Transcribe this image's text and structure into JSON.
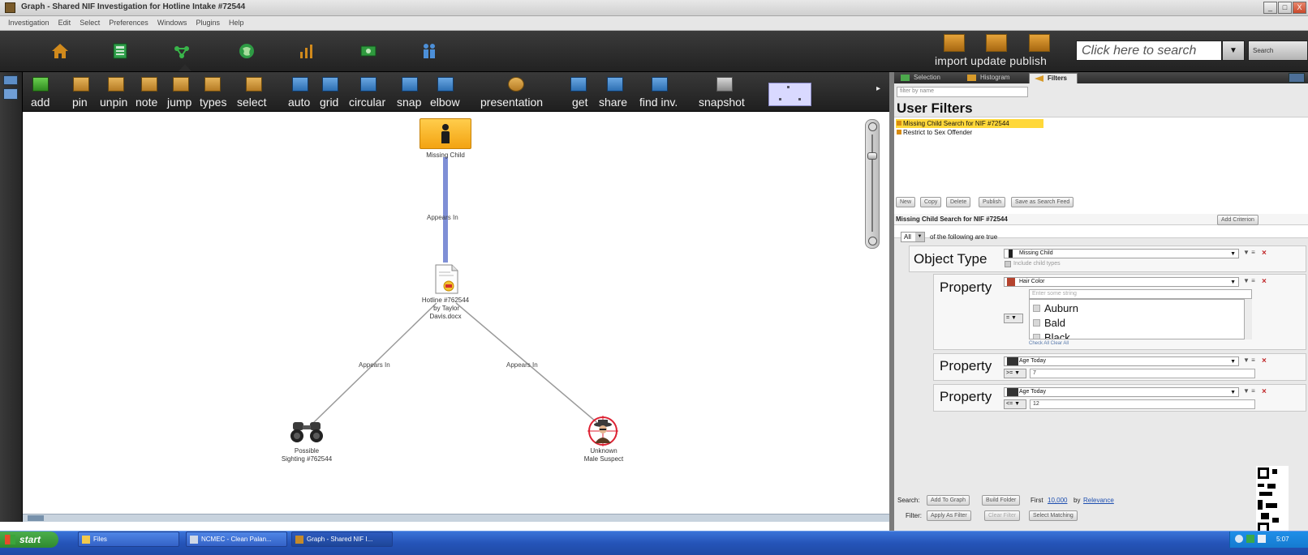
{
  "window": {
    "title": "Graph - Shared NIF Investigation for Hotline Intake #72544",
    "controls": [
      "_",
      "□",
      "X"
    ]
  },
  "menubar": {
    "items": [
      "Investigation",
      "Edit",
      "Select",
      "Preferences",
      "Windows",
      "Plugins",
      "Help"
    ]
  },
  "main_toolbar": {
    "nav_icons": [
      "home-icon",
      "browser-icon",
      "graph-icon",
      "map-icon",
      "chart-icon",
      "money-icon",
      "people-icon"
    ],
    "actions_label": "import update publish",
    "search_placeholder": "Click here to search",
    "search_button": "Search"
  },
  "graph_toolbar": {
    "buttons": [
      {
        "label": "add",
        "icon": "add-icon"
      },
      {
        "label": "pin",
        "icon": "pin-icon"
      },
      {
        "label": "unpin",
        "icon": "unpin-icon"
      },
      {
        "label": "note",
        "icon": "note-icon"
      },
      {
        "label": "jump",
        "icon": "jump-icon"
      },
      {
        "label": "types",
        "icon": "types-icon"
      },
      {
        "label": "select",
        "icon": "select-icon"
      },
      {
        "label": "auto",
        "icon": "auto-layout-icon"
      },
      {
        "label": "grid",
        "icon": "grid-layout-icon"
      },
      {
        "label": "circular",
        "icon": "circular-layout-icon"
      },
      {
        "label": "snap",
        "icon": "snap-icon"
      },
      {
        "label": "elbow",
        "icon": "elbow-icon"
      },
      {
        "label": "presentation",
        "icon": "presentation-icon"
      },
      {
        "label": "get",
        "icon": "get-icon"
      },
      {
        "label": "share",
        "icon": "share-icon"
      },
      {
        "label": "find inv.",
        "icon": "find-investigation-icon"
      },
      {
        "label": "snapshot",
        "icon": "snapshot-icon"
      }
    ]
  },
  "graph": {
    "nodes": {
      "missing_child": "Missing Child",
      "hotline": "Hotline #762544\n by Taylor\nDavis.docx",
      "sighting": "Possible\nSighting #762544",
      "suspect": "Unknown\nMale Suspect"
    },
    "edges": {
      "e1": "Appears In",
      "e2": "Appears In",
      "e3": "Appears In"
    }
  },
  "right_panel": {
    "tabs": [
      "Selection",
      "Histogram",
      "Filters"
    ],
    "active_tab": "Filters",
    "filter_name_placeholder": "filter by name",
    "user_filters_heading": "User Filters",
    "filters": [
      {
        "label": "Missing Child Search for NIF #72544",
        "selected": true
      },
      {
        "label": "Restrict to Sex Offender",
        "selected": false
      }
    ],
    "filter_actions": [
      "New",
      "Copy",
      "Delete",
      "Publish",
      "Save as Search Feed"
    ],
    "criteria_title": "Missing Child Search for NIF #72544",
    "add_criterion": "Add Criterion",
    "match_mode": "All",
    "match_suffix": "of the following are true",
    "object_type": {
      "label": "Object Type",
      "value": "Missing Child",
      "include_child_types": "Include child types"
    },
    "property_hair": {
      "label": "Property",
      "value": "Hair Color",
      "search_placeholder": "Enter some string",
      "options": [
        "Auburn",
        "Bald",
        "Black"
      ],
      "footer": "Check All  Clear All",
      "operator": "="
    },
    "property_age_min": {
      "label": "Property",
      "value": "Age Today",
      "operator": ">=",
      "amount": "7"
    },
    "property_age_max": {
      "label": "Property",
      "value": "Age Today",
      "operator": "<=",
      "amount": "12"
    },
    "search_bar": {
      "label": "Search:",
      "add_to_graph": "Add To Graph",
      "build_folder": "Build Folder",
      "first_prefix": "First",
      "first_count": "10,000",
      "by": "by",
      "relevance": "Relevance"
    },
    "filter_bar": {
      "label": "Filter:",
      "apply": "Apply As Filter",
      "clear": "Clear Filter",
      "select_matching": "Select Matching"
    }
  },
  "taskbar": {
    "start": "start",
    "tasks": [
      "Files",
      "NCMEC - Clean Palan...",
      "Graph - Shared NIF I..."
    ],
    "clock": "5:07"
  },
  "colors": {
    "toolbar_dark": "#2a2a2a",
    "node_orange": "#f6b22a",
    "edge_blue": "#7f8fd6",
    "selected_filter": "#ffd83a",
    "taskbar_blue": "#2554b8"
  }
}
